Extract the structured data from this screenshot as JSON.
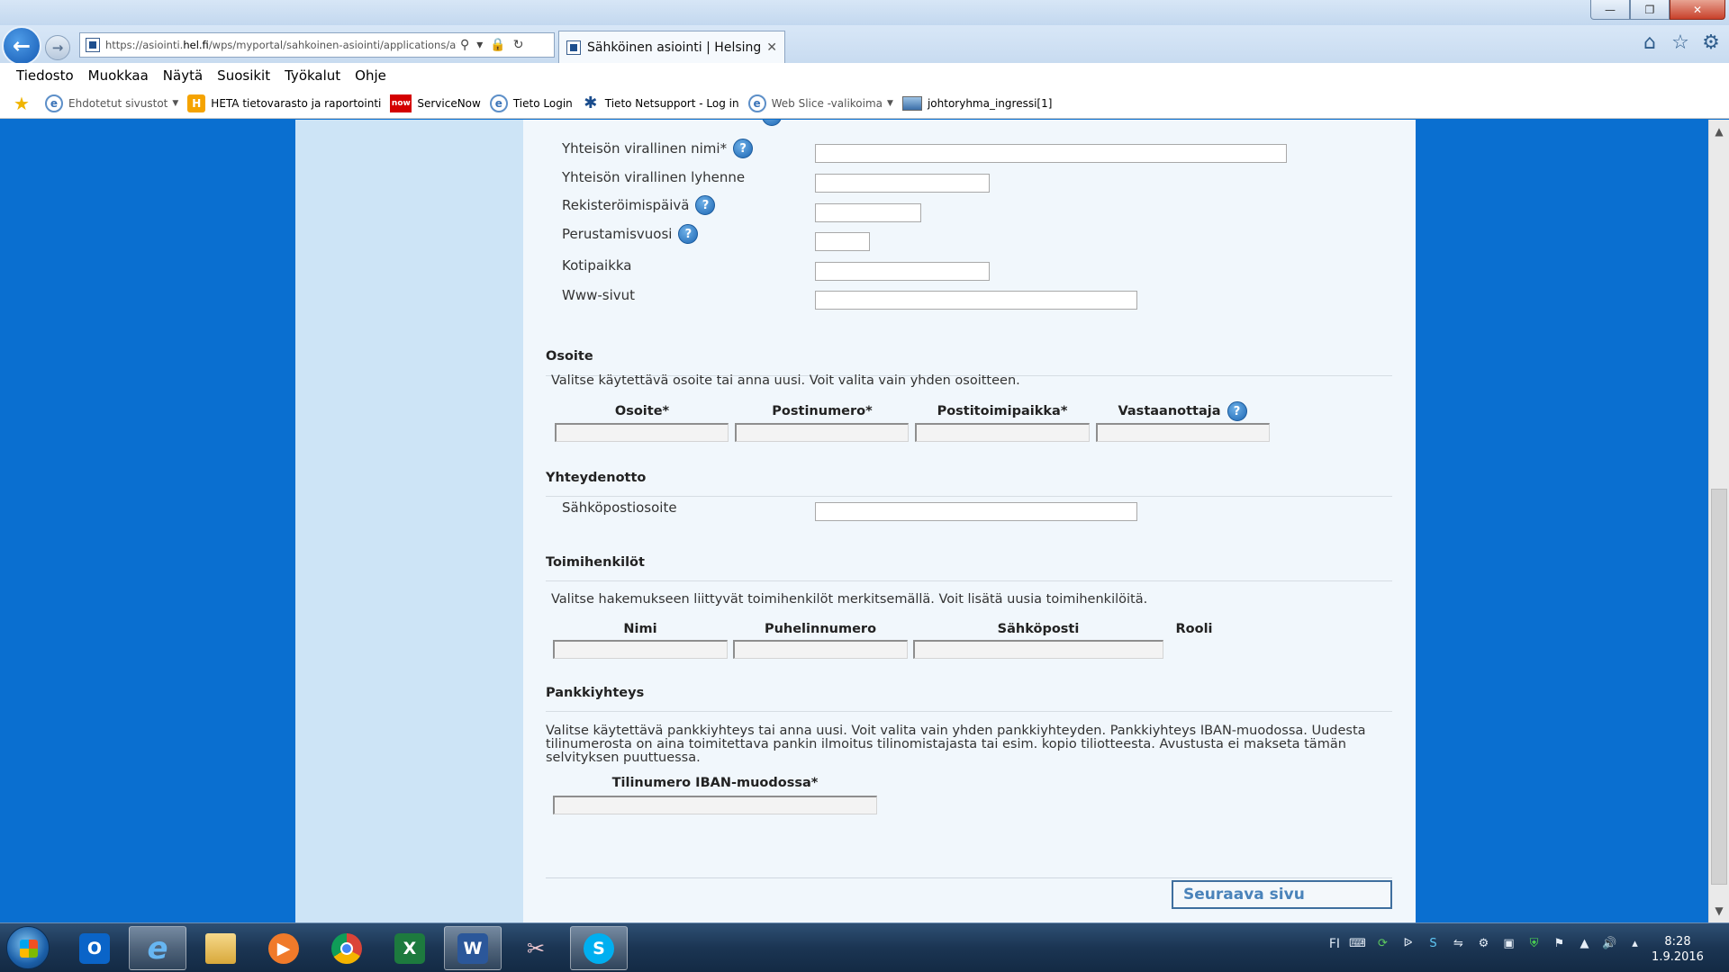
{
  "browser": {
    "url_host": "https://asiointi.",
    "url_domain": "hel.fi",
    "url_path": "/wps/myportal/sahkoinen-asiointi/applications/avust",
    "tab_title": "Sähköinen asiointi | Helsing...",
    "menu": [
      "Tiedosto",
      "Muokkaa",
      "Näytä",
      "Suosikit",
      "Työkalut",
      "Ohje"
    ],
    "favorites": [
      {
        "label": "Ehdotetut sivustot",
        "icon": "ie-icon",
        "dim": true,
        "dropdown": true
      },
      {
        "label": "HETA tietovarasto ja raportointi",
        "icon": "heta-icon"
      },
      {
        "label": "ServiceNow",
        "icon": "servicenow-icon"
      },
      {
        "label": "Tieto Login",
        "icon": "ie-icon"
      },
      {
        "label": "Tieto Netsupport - Log in",
        "icon": "netsupport-icon"
      },
      {
        "label": "Web Slice -valikoima",
        "icon": "ie-icon",
        "dim": true,
        "dropdown": true
      },
      {
        "label": "johtoryhma_ingressi[1]",
        "icon": "image-icon"
      }
    ]
  },
  "form": {
    "basic_fields": [
      {
        "label": "Yhteisön virallinen nimi*",
        "help": true,
        "value": ""
      },
      {
        "label": "Yhteisön virallinen lyhenne",
        "help": false,
        "value": ""
      },
      {
        "label": "Rekisteröimispäivä",
        "help": true,
        "value": ""
      },
      {
        "label": "Perustamisvuosi",
        "help": true,
        "value": ""
      },
      {
        "label": "Kotipaikka",
        "help": false,
        "value": ""
      },
      {
        "label": "Www-sivut",
        "help": false,
        "value": ""
      }
    ],
    "address": {
      "title": "Osoite",
      "desc": "Valitse käytettävä osoite tai anna uusi. Voit valita vain yhden osoitteen.",
      "columns": [
        "Osoite*",
        "Postinumero*",
        "Postitoimipaikka*",
        "Vastaanottaja"
      ]
    },
    "contact": {
      "title": "Yhteydenotto",
      "email_label": "Sähköpostiosoite",
      "email_value": ""
    },
    "staff": {
      "title": "Toimihenkilöt",
      "desc": "Valitse hakemukseen liittyvät toimihenkilöt merkitsemällä. Voit lisätä uusia toimihenkilöitä.",
      "columns": [
        "Nimi",
        "Puhelinnumero",
        "Sähköposti",
        "Rooli"
      ]
    },
    "bank": {
      "title": "Pankkiyhteys",
      "desc": " Valitse käytettävä pankkiyhteys tai anna uusi. Voit valita vain yhden pankkiyhteyden. Pankkiyhteys IBAN-muodossa. Uudesta tilinumerosta on aina toimitettava pankin ilmoitus tilinomistajasta tai esim. kopio tiliotteesta. Avustusta ei makseta tämän selvityksen puuttuessa.",
      "column": "Tilinumero IBAN-muodossa*"
    },
    "next_button": "Seuraava sivu"
  },
  "taskbar": {
    "language": "FI",
    "time": "8:28",
    "date": "1.9.2016"
  }
}
